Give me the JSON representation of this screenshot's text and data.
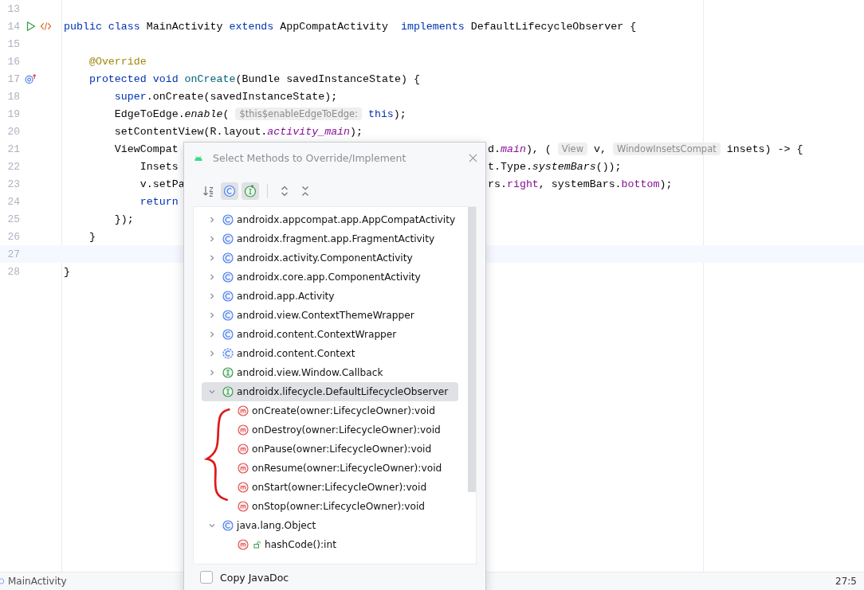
{
  "editor": {
    "lines": [
      {
        "number": "13",
        "current": false
      },
      {
        "number": "14",
        "current": false,
        "markers": [
          {
            "kind": "run"
          },
          {
            "kind": "code"
          }
        ],
        "tokens": [
          {
            "text": "public class ",
            "kind": "kw"
          },
          {
            "text": "MainActivity ",
            "kind": "plain"
          },
          {
            "text": "extends ",
            "kind": "kw"
          },
          {
            "text": "AppCompatActivity  ",
            "kind": "plain"
          },
          {
            "text": "implements ",
            "kind": "kw"
          },
          {
            "text": "DefaultLifecycleObserver {",
            "kind": "plain"
          }
        ]
      },
      {
        "number": "15",
        "current": false
      },
      {
        "number": "16",
        "current": false,
        "tokens": [
          {
            "text": "    @Override",
            "kind": "ann"
          }
        ]
      },
      {
        "number": "17",
        "current": false,
        "markers": [
          {
            "kind": "override"
          }
        ],
        "tokens": [
          {
            "text": "    protected void ",
            "kind": "kw"
          },
          {
            "text": "onCreate",
            "kind": "decl"
          },
          {
            "text": "(Bundle savedInstanceState) {",
            "kind": "plain"
          }
        ]
      },
      {
        "number": "18",
        "current": false,
        "tokens": [
          {
            "text": "        super",
            "kind": "kw"
          },
          {
            "text": ".onCreate(savedInstanceState);",
            "kind": "plain"
          }
        ]
      },
      {
        "number": "19",
        "current": false,
        "tokens": [
          {
            "text": "        EdgeToEdge.",
            "kind": "plain"
          },
          {
            "text": "enable",
            "kind": "static"
          },
          {
            "text": "( ",
            "kind": "plain"
          },
          {
            "text": "$this$enableEdgeToEdge:",
            "kind": "hint"
          },
          {
            "text": " this",
            "kind": "kw"
          },
          {
            "text": ");",
            "kind": "plain"
          }
        ]
      },
      {
        "number": "20",
        "current": false,
        "tokens": [
          {
            "text": "        setContentView(R.layout.",
            "kind": "plain"
          },
          {
            "text": "activity_main",
            "kind": "field"
          },
          {
            "text": ");",
            "kind": "plain"
          }
        ]
      },
      {
        "number": "21",
        "current": false,
        "tokens": [
          {
            "text": "        ViewCompat",
            "kind": "plain"
          }
        ],
        "right": [
          {
            "text": "d.",
            "kind": "plain"
          },
          {
            "text": "main",
            "kind": "field"
          },
          {
            "text": "), ( ",
            "kind": "plain"
          },
          {
            "text": "View",
            "kind": "hint"
          },
          {
            "text": " v, ",
            "kind": "plain"
          },
          {
            "text": "WindowInsetsCompat",
            "kind": "hint"
          },
          {
            "text": " insets) -> {",
            "kind": "plain"
          }
        ]
      },
      {
        "number": "22",
        "current": false,
        "tokens": [
          {
            "text": "            Insets",
            "kind": "plain"
          }
        ],
        "right": [
          {
            "text": "t.Type.",
            "kind": "plain"
          },
          {
            "text": "systemBars",
            "kind": "static"
          },
          {
            "text": "());",
            "kind": "plain"
          }
        ]
      },
      {
        "number": "23",
        "current": false,
        "tokens": [
          {
            "text": "            v.setPa",
            "kind": "plain"
          }
        ],
        "right": [
          {
            "text": "rs.",
            "kind": "plain"
          },
          {
            "text": "right",
            "kind": "prop"
          },
          {
            "text": ", systemBars.",
            "kind": "plain"
          },
          {
            "text": "bottom",
            "kind": "prop"
          },
          {
            "text": ");",
            "kind": "plain"
          }
        ]
      },
      {
        "number": "24",
        "current": false,
        "tokens": [
          {
            "text": "            return",
            "kind": "kw"
          }
        ]
      },
      {
        "number": "25",
        "current": false,
        "tokens": [
          {
            "text": "        });",
            "kind": "plain"
          }
        ]
      },
      {
        "number": "26",
        "current": false,
        "tokens": [
          {
            "text": "    }",
            "kind": "plain"
          }
        ]
      },
      {
        "number": "27",
        "current": true
      },
      {
        "number": "28",
        "current": false,
        "tokens": [
          {
            "text": "}",
            "kind": "plain"
          }
        ]
      }
    ]
  },
  "dialog": {
    "title": "Select Methods to Override/Implement",
    "toolbar": {
      "toggles": [
        {
          "kind": "sort",
          "selected": false
        },
        {
          "kind": "class",
          "selected": true
        },
        {
          "kind": "interface",
          "selected": true
        }
      ]
    },
    "tree": [
      {
        "label": "androidx.appcompat.app.AppCompatActivity",
        "kind": "class",
        "expanded": false,
        "selected": false
      },
      {
        "label": "androidx.fragment.app.FragmentActivity",
        "kind": "class",
        "expanded": false,
        "selected": false
      },
      {
        "label": "androidx.activity.ComponentActivity",
        "kind": "class",
        "expanded": false,
        "selected": false
      },
      {
        "label": "androidx.core.app.ComponentActivity",
        "kind": "class",
        "expanded": false,
        "selected": false
      },
      {
        "label": "android.app.Activity",
        "kind": "class",
        "expanded": false,
        "selected": false
      },
      {
        "label": "android.view.ContextThemeWrapper",
        "kind": "class",
        "expanded": false,
        "selected": false
      },
      {
        "label": "android.content.ContextWrapper",
        "kind": "class",
        "expanded": false,
        "selected": false
      },
      {
        "label": "android.content.Context",
        "kind": "abstract_class",
        "expanded": false,
        "selected": false
      },
      {
        "label": "android.view.Window.Callback",
        "kind": "interface",
        "expanded": false,
        "selected": false
      },
      {
        "label": "androidx.lifecycle.DefaultLifecycleObserver",
        "kind": "interface",
        "expanded": true,
        "selected": true,
        "children": [
          {
            "label": "onCreate(owner:LifecycleOwner):void",
            "kind": "method",
            "selected": false
          },
          {
            "label": "onDestroy(owner:LifecycleOwner):void",
            "kind": "method",
            "selected": false
          },
          {
            "label": "onPause(owner:LifecycleOwner):void",
            "kind": "method",
            "selected": false
          },
          {
            "label": "onResume(owner:LifecycleOwner):void",
            "kind": "method",
            "selected": false
          },
          {
            "label": "onStart(owner:LifecycleOwner):void",
            "kind": "method",
            "selected": false
          },
          {
            "label": "onStop(owner:LifecycleOwner):void",
            "kind": "method",
            "selected": false
          }
        ]
      },
      {
        "label": "java.lang.Object",
        "kind": "class",
        "expanded": true,
        "selected": false,
        "children": [
          {
            "label": "hashCode():int",
            "kind": "public_method",
            "selected": false
          }
        ]
      }
    ],
    "copy_javadoc": {
      "label": "Copy JavaDoc",
      "checked": false
    }
  },
  "status_bar": {
    "file": "MainActivity",
    "position": "27:5"
  }
}
